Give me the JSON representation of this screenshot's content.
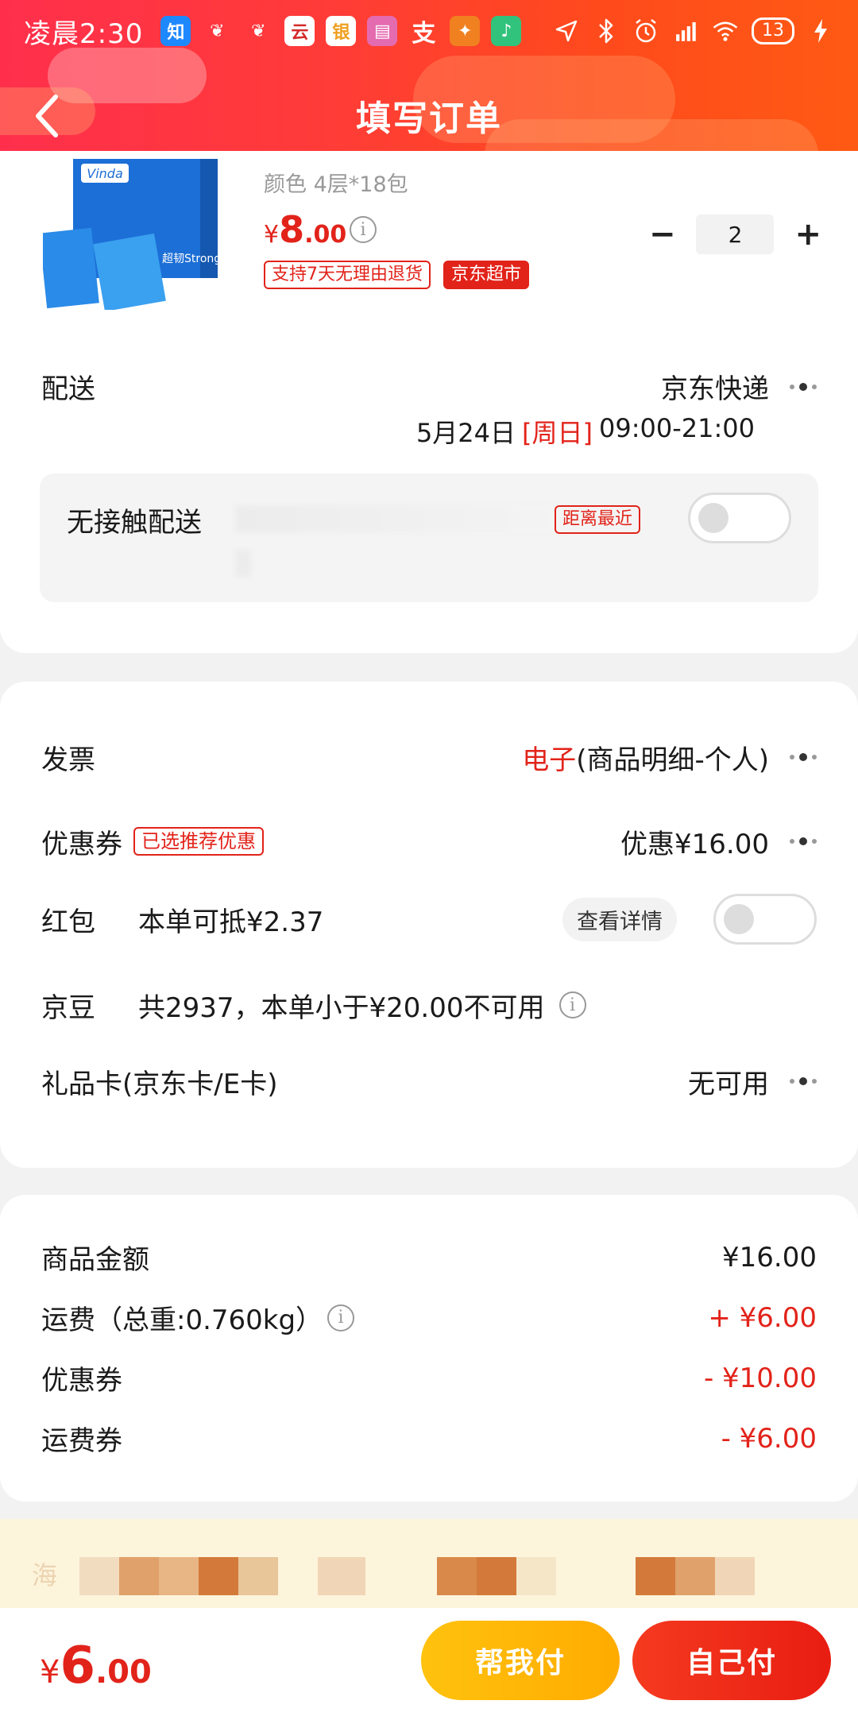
{
  "status_bar": {
    "time": "凌晨2:30",
    "battery": "13",
    "app_icons": [
      {
        "icon": "zhihu-icon",
        "glyph": "知",
        "color": "#1e88ff"
      },
      {
        "icon": "leaf-icon",
        "glyph": "❦",
        "color": "transparent"
      },
      {
        "icon": "leaf2-icon",
        "glyph": "❦",
        "color": "transparent"
      },
      {
        "icon": "yunshanfu-icon",
        "glyph": "云",
        "color": "#d42a2a"
      },
      {
        "icon": "bank-icon",
        "glyph": "银",
        "color": "#f0a020"
      },
      {
        "icon": "gallery-icon",
        "glyph": "▤",
        "color": "#e56bb0"
      },
      {
        "icon": "alipay-icon",
        "glyph": "支",
        "color": "transparent"
      },
      {
        "icon": "runner-icon",
        "glyph": "✦",
        "color": "#f08020"
      },
      {
        "icon": "music-icon",
        "glyph": "♪",
        "color": "#31c27c"
      }
    ]
  },
  "nav": {
    "title": "填写订单",
    "back_icon": "chevron-left-icon"
  },
  "product": {
    "spec": "颜色 4层*18包",
    "price_symbol": "¥",
    "price_int": "8",
    "price_dec": ".00",
    "return_tag": "支持7天无理由退货",
    "store_tag": "京东超市",
    "quantity": "2",
    "minus": "−",
    "plus": "+",
    "brand_text": "Vinda",
    "pack_text": "超韧Strong"
  },
  "delivery": {
    "label": "配送",
    "carrier": "京东快递",
    "date": "5月24日",
    "weekday": "[周日]",
    "time_range": "09:00-21:00",
    "contactless_label": "无接触配送",
    "nearest_tag": "距离最近"
  },
  "invoice": {
    "label": "发票",
    "type_highlight": "电子",
    "type_detail": "(商品明细-个人)"
  },
  "coupon": {
    "label": "优惠券",
    "tag": "已选推荐优惠",
    "value": "优惠¥16.00"
  },
  "red_packet": {
    "label": "红包",
    "desc": "本单可抵¥2.37",
    "detail_btn": "查看详情"
  },
  "jingdou": {
    "label": "京豆",
    "desc": "共2937，本单小于¥20.00不可用"
  },
  "gift_card": {
    "label": "礼品卡(京东卡/E卡)",
    "value": "无可用"
  },
  "summary": [
    {
      "label": "商品金额",
      "value": "¥16.00",
      "highlight": false,
      "info": false
    },
    {
      "label": "运费（总重:0.760kg）",
      "value": "+ ¥6.00",
      "highlight": true,
      "info": true
    },
    {
      "label": "优惠券",
      "value": "- ¥10.00",
      "highlight": true,
      "info": false
    },
    {
      "label": "运费券",
      "value": "- ¥6.00",
      "highlight": true,
      "info": false
    }
  ],
  "banner": {
    "lead": "海"
  },
  "bottom": {
    "total_symbol": "¥",
    "total_int": "6",
    "total_dec": ".00",
    "help_pay": "帮我付",
    "self_pay": "自己付"
  },
  "colors": {
    "accent": "#e2231a",
    "help_pay": "#ffb400",
    "self_pay": "#f0241a"
  }
}
